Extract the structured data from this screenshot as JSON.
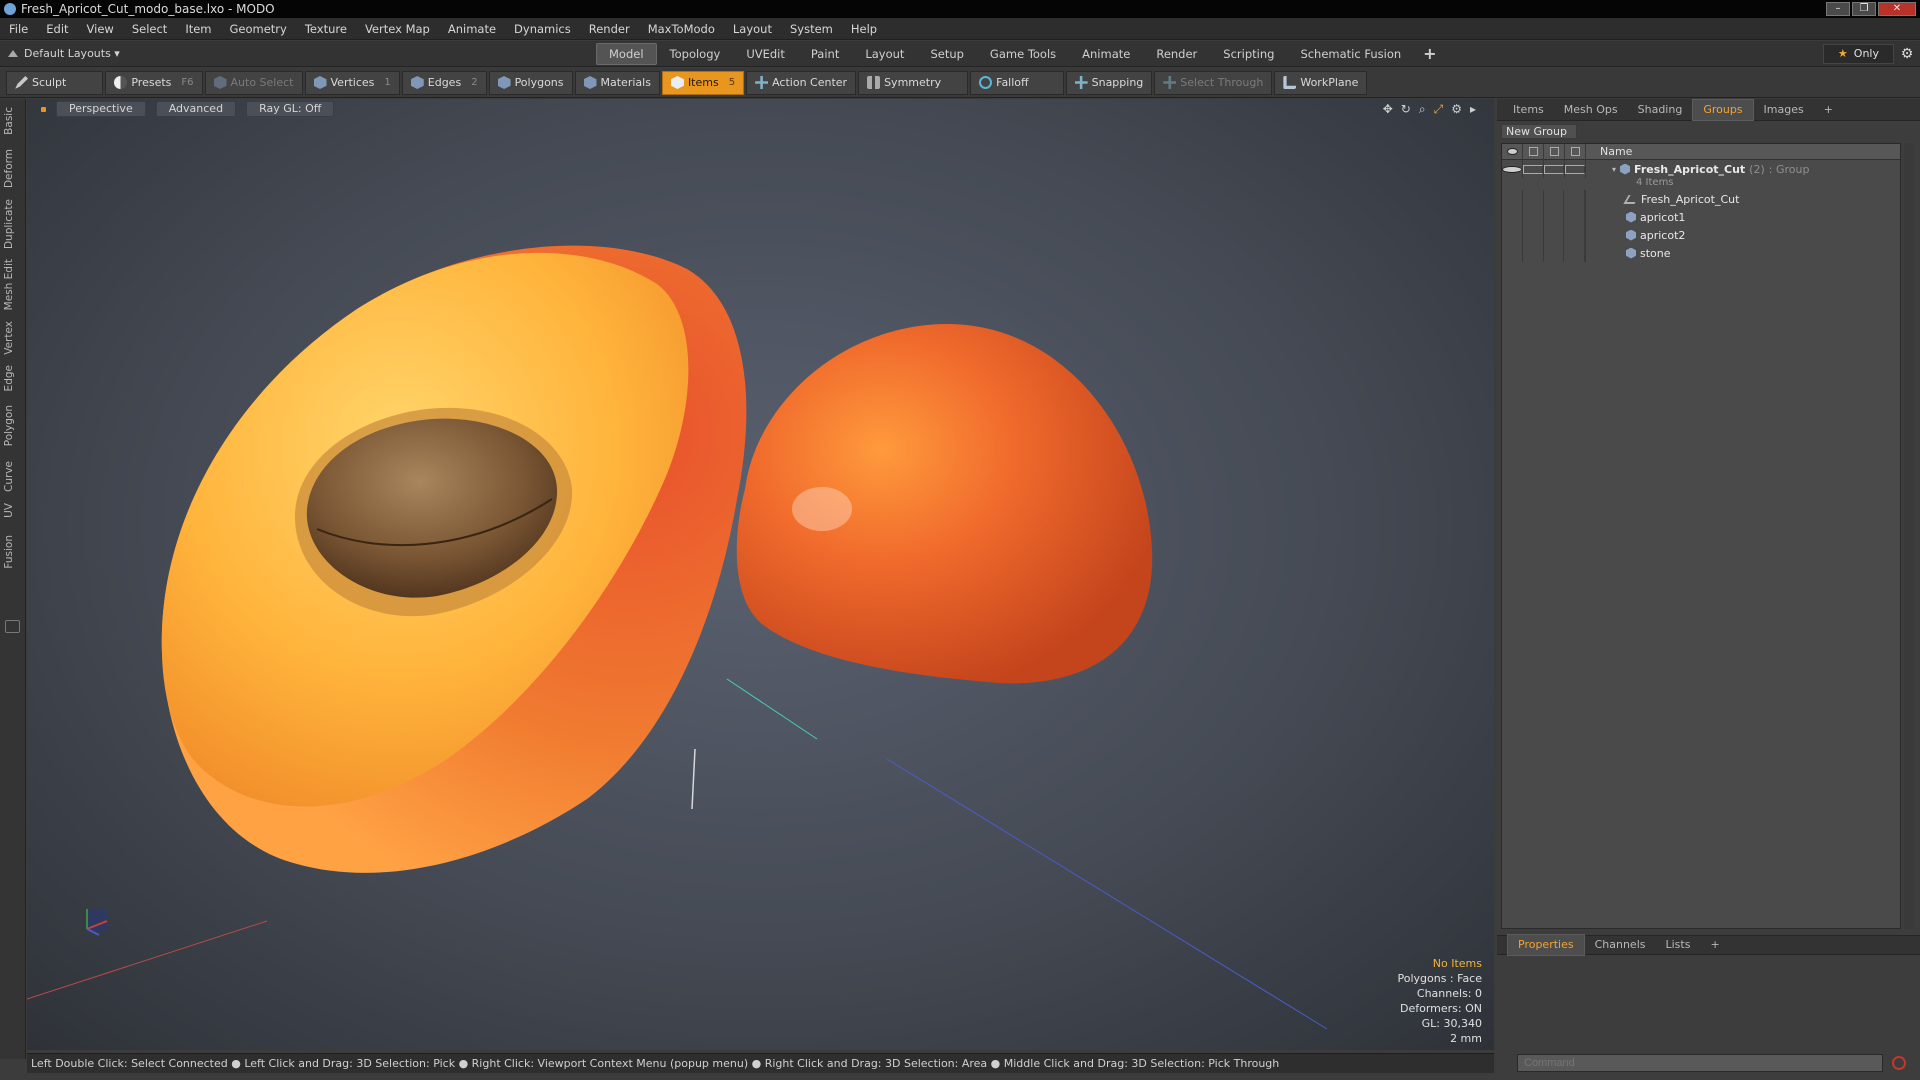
{
  "window": {
    "title": "Fresh_Apricot_Cut_modo_base.lxo - MODO",
    "buttons": [
      "–",
      "❐",
      "✕"
    ]
  },
  "menu": [
    "File",
    "Edit",
    "View",
    "Select",
    "Item",
    "Geometry",
    "Texture",
    "Vertex Map",
    "Animate",
    "Dynamics",
    "Render",
    "MaxToModo",
    "Layout",
    "System",
    "Help"
  ],
  "layout": {
    "selector": "Default Layouts ▾",
    "tabs": [
      "Model",
      "Topology",
      "UVEdit",
      "Paint",
      "Layout",
      "Setup",
      "Game Tools",
      "Animate",
      "Render",
      "Scripting",
      "Schematic Fusion",
      "+"
    ],
    "active_tab": "Model",
    "only_label": "Only"
  },
  "toolbar": {
    "sculpt": "Sculpt",
    "presets": "Presets",
    "presets_key": "F6",
    "auto_select": "Auto Select",
    "vertices": "Vertices",
    "vertices_key": "1",
    "edges": "Edges",
    "edges_key": "2",
    "polygons": "Polygons",
    "materials": "Materials",
    "items": "Items",
    "items_key": "5",
    "action_center": "Action Center",
    "symmetry": "Symmetry",
    "falloff": "Falloff",
    "snapping": "Snapping",
    "select_through": "Select Through",
    "workplane": "WorkPlane"
  },
  "left_tabs": [
    "Basic",
    "Deform",
    "Duplicate",
    "Mesh Edit",
    "Vertex",
    "Edge",
    "Polygon",
    "Curve",
    "UV",
    "Fusion"
  ],
  "viewport": {
    "view": "Perspective",
    "shading": "Advanced",
    "raygl": "Ray GL: Off",
    "info": {
      "selection": "No Items",
      "polygons": "Polygons : Face",
      "channels": "Channels: 0",
      "deformers": "Deformers: ON",
      "gl": "GL: 30,340",
      "scale": "2 mm"
    }
  },
  "status": "Left Double Click: Select Connected ● Left Click and Drag: 3D Selection: Pick ● Right Click: Viewport Context Menu (popup menu) ● Right Click and Drag: 3D Selection: Area ● Middle Click and Drag: 3D Selection: Pick Through",
  "right_panel": {
    "tabs": [
      "Items",
      "Mesh Ops",
      "Shading",
      "Groups",
      "Images",
      "+"
    ],
    "active_tab": "Groups",
    "new_group": "New Group",
    "name_header": "Name",
    "group": {
      "name": "Fresh_Apricot_Cut",
      "count": "(2)",
      "type": ": Group",
      "sub": "4 Items"
    },
    "children": [
      "Fresh_Apricot_Cut",
      "apricot1",
      "apricot2",
      "stone"
    ],
    "bottom_tabs": [
      "Properties",
      "Channels",
      "Lists",
      "+"
    ],
    "bottom_active": "Properties",
    "command_placeholder": "Command"
  },
  "colors": {
    "accent": "#e8961e",
    "tab_active_text": "#f2a434"
  }
}
